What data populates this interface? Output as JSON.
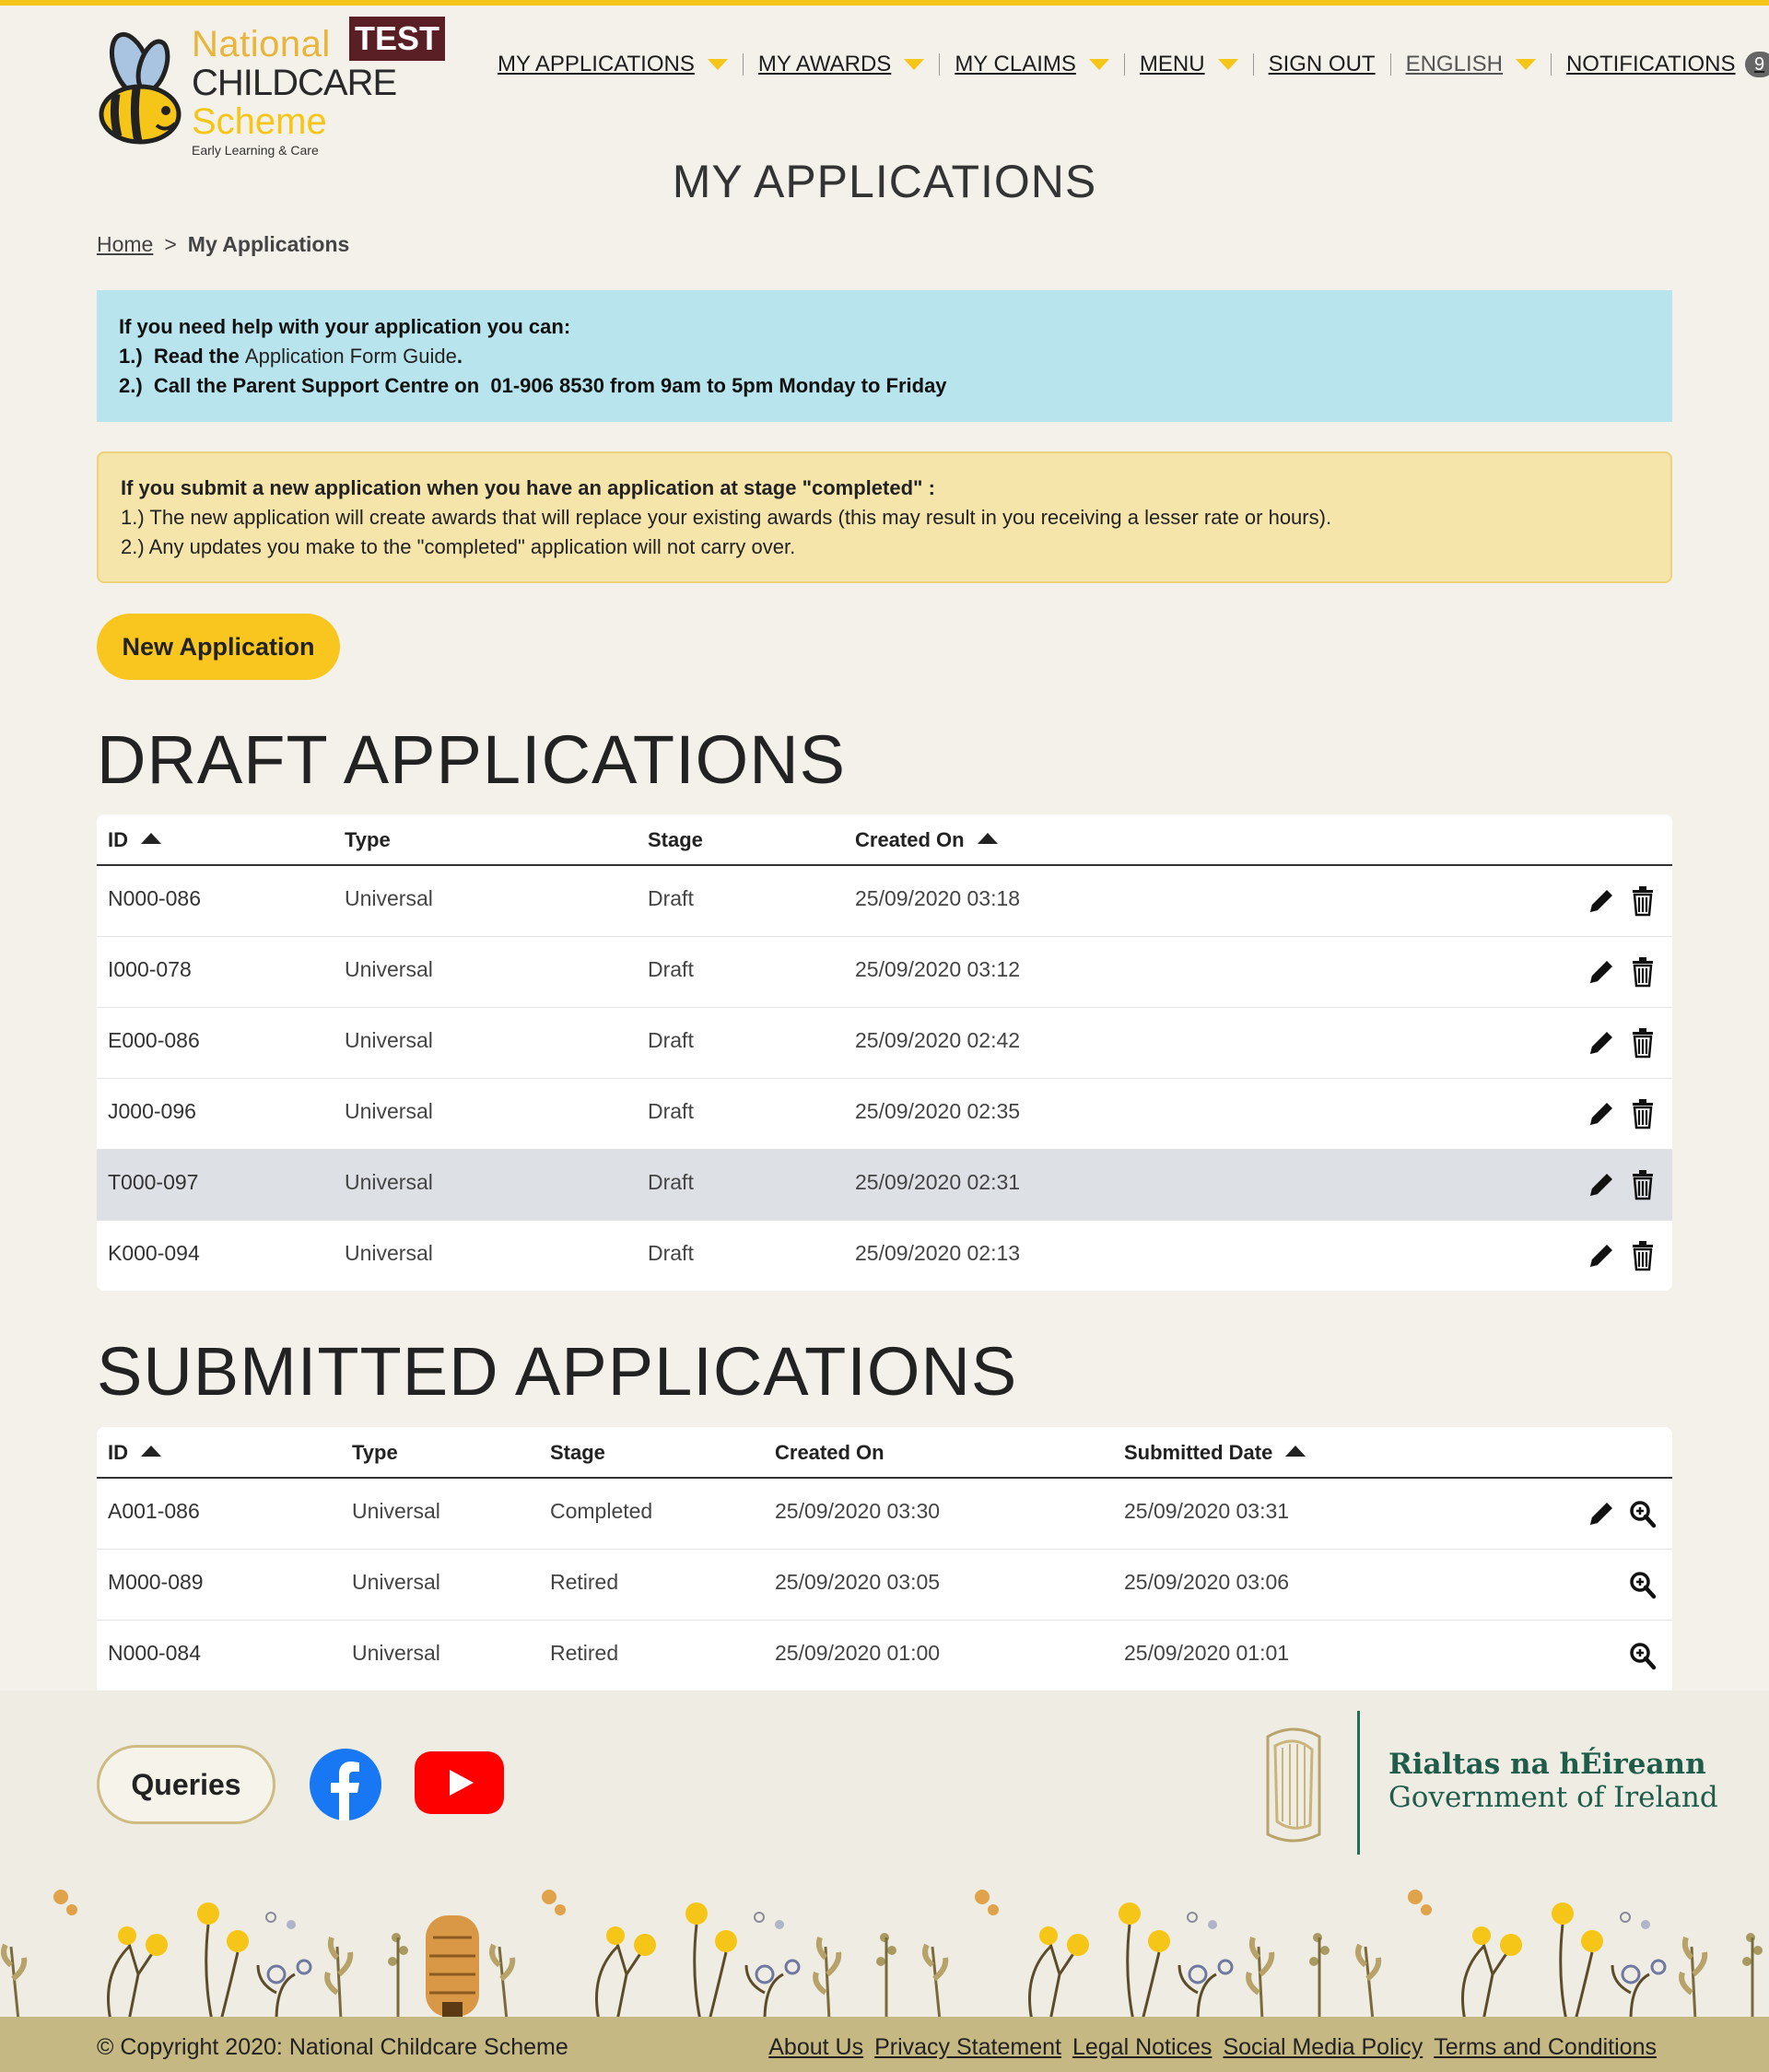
{
  "brand": {
    "line1": "National",
    "line2": "CHILDCARE",
    "line3": "Scheme",
    "line4": "Early Learning & Care",
    "env_badge": "TEST",
    "colors": {
      "accent": "#f5c518",
      "text": "#222222",
      "badge": "#5a1f24"
    }
  },
  "nav": {
    "items": [
      {
        "label": "MY APPLICATIONS",
        "dropdown": true
      },
      {
        "label": "MY AWARDS",
        "dropdown": true
      },
      {
        "label": "MY CLAIMS",
        "dropdown": true
      },
      {
        "label": "MENU",
        "dropdown": true
      },
      {
        "label": "SIGN OUT",
        "dropdown": false
      },
      {
        "label": "ENGLISH",
        "dropdown": true
      },
      {
        "label": "NOTIFICATIONS",
        "dropdown": false
      }
    ],
    "notification_count": "9"
  },
  "page": {
    "title": "MY APPLICATIONS",
    "breadcrumb": {
      "home": "Home",
      "separator": ">",
      "current": "My Applications"
    }
  },
  "help_box": {
    "heading": "If you need help with your application you can:",
    "line1_prefix": "1.)  Read the ",
    "line1_link": "Application Form Guide",
    "line1_suffix": ".",
    "line2": "2.)  Call the Parent Support Centre on  01-906 8530 from 9am to 5pm Monday to Friday"
  },
  "warning_box": {
    "heading": "If you submit a new application when you have an application at stage \"completed\" :",
    "line1": "1.) The new application will create awards that will replace your existing awards (this may result in you receiving a lesser rate or hours).",
    "line2": "2.) Any updates you make to the \"completed\" application will not carry over."
  },
  "new_application_label": "New Application",
  "draft": {
    "title": "DRAFT APPLICATIONS",
    "columns": [
      "ID",
      "Type",
      "Stage",
      "Created On"
    ],
    "rows": [
      {
        "id": "N000-086",
        "type": "Universal",
        "stage": "Draft",
        "created": "25/09/2020 03:18"
      },
      {
        "id": "I000-078",
        "type": "Universal",
        "stage": "Draft",
        "created": "25/09/2020 03:12"
      },
      {
        "id": "E000-086",
        "type": "Universal",
        "stage": "Draft",
        "created": "25/09/2020 02:42"
      },
      {
        "id": "J000-096",
        "type": "Universal",
        "stage": "Draft",
        "created": "25/09/2020 02:35"
      },
      {
        "id": "T000-097",
        "type": "Universal",
        "stage": "Draft",
        "created": "25/09/2020 02:31"
      },
      {
        "id": "K000-094",
        "type": "Universal",
        "stage": "Draft",
        "created": "25/09/2020 02:13"
      }
    ]
  },
  "submitted": {
    "title": "SUBMITTED APPLICATIONS",
    "columns": [
      "ID",
      "Type",
      "Stage",
      "Created On",
      "Submitted Date"
    ],
    "rows": [
      {
        "id": "A001-086",
        "type": "Universal",
        "stage": "Completed",
        "created": "25/09/2020 03:30",
        "submitted": "25/09/2020 03:31"
      },
      {
        "id": "M000-089",
        "type": "Universal",
        "stage": "Retired",
        "created": "25/09/2020 03:05",
        "submitted": "25/09/2020 03:06"
      },
      {
        "id": "N000-084",
        "type": "Universal",
        "stage": "Retired",
        "created": "25/09/2020 01:00",
        "submitted": "25/09/2020 01:01"
      }
    ]
  },
  "footer": {
    "queries_label": "Queries",
    "gov_irish": "Rialtas na hÉireann",
    "gov_english": "Government of Ireland",
    "copyright": "© Copyright 2020: National Childcare Scheme",
    "links": [
      "About Us",
      "Privacy Statement",
      "Legal Notices",
      "Social Media Policy",
      "Terms and Conditions"
    ]
  }
}
